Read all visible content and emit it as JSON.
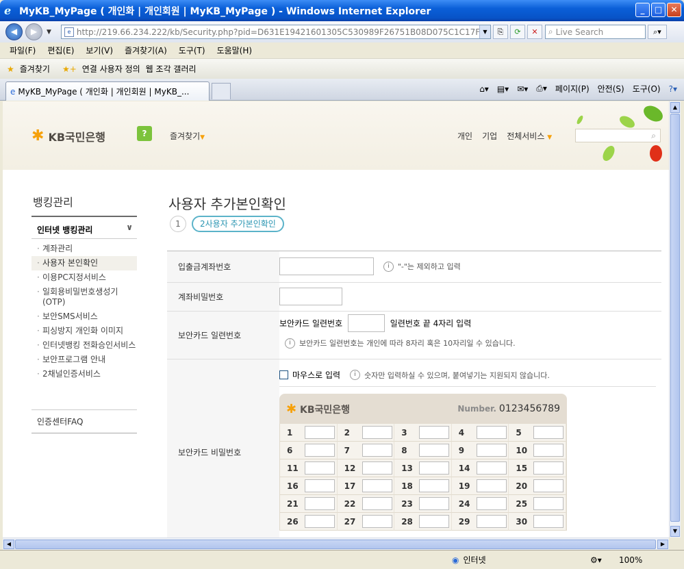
{
  "window": {
    "title": "MyKB_MyPage ( 개인화 | 개인회원 | MyKB_MyPage ) - Windows Internet Explorer"
  },
  "address": {
    "url": "http://219.66.234.222/kb/Security.php?pid=D631E19421601305C530989F26751B08D075C1C17F284A0AD2&n=",
    "search_placeholder": "Live Search"
  },
  "menu": [
    "파일(F)",
    "편집(E)",
    "보기(V)",
    "즐겨찾기(A)",
    "도구(T)",
    "도움말(H)"
  ],
  "favbar": {
    "favorites": "즐겨찾기",
    "item1": "연결 사용자 정의",
    "item2": "웹 조각 갤러리"
  },
  "tab": {
    "title": "MyKB_MyPage ( 개인화 | 개인회원 | MyKB_..."
  },
  "commands": {
    "page": "페이지(P)",
    "safety": "안전(S)",
    "tools": "도구(O)"
  },
  "site": {
    "logo": "KB국민은행",
    "favorites": "즐겨찾기",
    "nav": [
      "개인",
      "기업",
      "전체서비스"
    ]
  },
  "sidebar": {
    "title": "뱅킹관리",
    "section": "인터넷 뱅킹관리",
    "items": [
      "계좌관리",
      "사용자 본인확인",
      "이용PC지정서비스",
      "일회용비밀번호생성기(OTP)",
      "보안SMS서비스",
      "피싱방지 개인화 이미지",
      "인터넷뱅킹 전화승인서비스",
      "보안프로그램 안내",
      "2채널인증서비스"
    ],
    "faq": "인증센터FAQ"
  },
  "main": {
    "title": "사용자 추가본인확인",
    "step1": "1",
    "step2": "2사용자 추가본인확인",
    "rows": {
      "account_label": "입출금계좌번호",
      "account_hint": "\"-\"는 제외하고 입력",
      "password_label": "계좌비밀번호",
      "serial_label": "보안카드 일련번호",
      "serial_prefix": "보안카드 일련번호",
      "serial_suffix": "일련번호 끝 4자리 입력",
      "serial_hint": "보안카드 일련번호는 개인에 따라 8자리 혹은 10자리일 수 있습니다.",
      "card_pw_label": "보안카드 비밀번호",
      "mouse_input": "마우스로 입력",
      "mouse_hint": "숫자만 입력하실 수 있으며, 붙여넣기는 지원되지 않습니다."
    },
    "card": {
      "brand": "KB국민은행",
      "number_label": "Number.",
      "number": "0123456789",
      "cells": [
        "1",
        "2",
        "3",
        "4",
        "5",
        "6",
        "7",
        "8",
        "9",
        "10",
        "11",
        "12",
        "13",
        "14",
        "15",
        "16",
        "17",
        "18",
        "19",
        "20",
        "21",
        "22",
        "23",
        "24",
        "25",
        "26",
        "27",
        "28",
        "29",
        "30"
      ]
    }
  },
  "status": {
    "zone": "인터넷",
    "zoom": "100%"
  }
}
